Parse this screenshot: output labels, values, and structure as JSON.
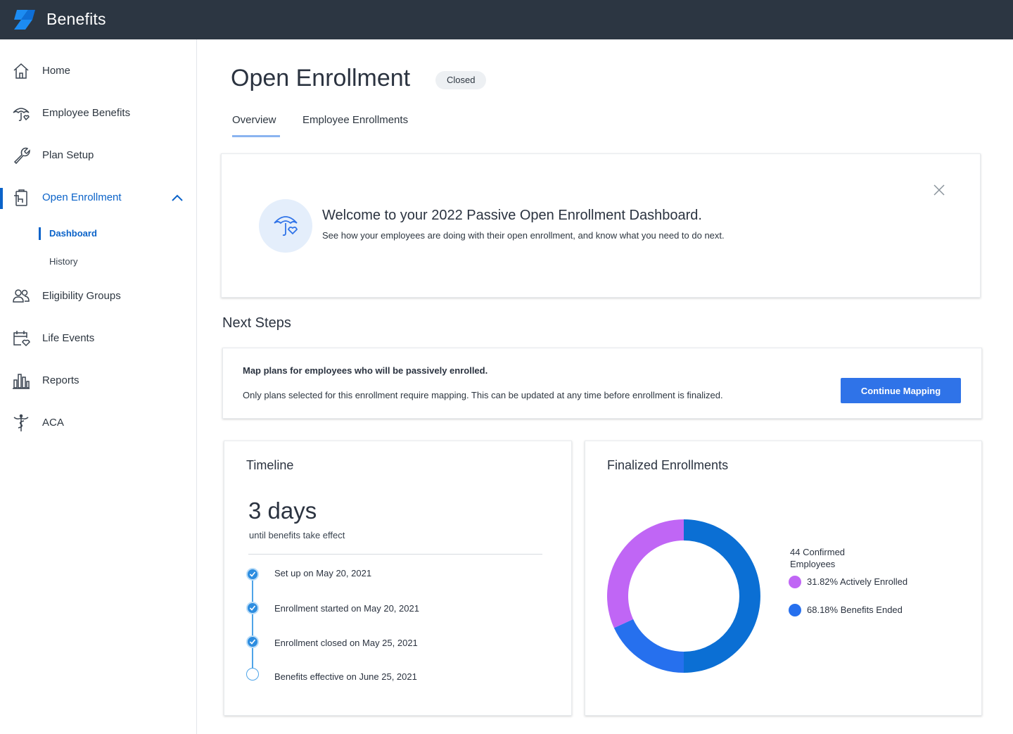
{
  "app": {
    "title": "Benefits",
    "logo_icon": "benefits-logo-icon",
    "brand_color": "#2c3642",
    "accent_color": "#0b63c9"
  },
  "sidebar": {
    "items": [
      {
        "label": "Home",
        "icon": "home-icon"
      },
      {
        "label": "Employee Benefits",
        "icon": "umbrella-heart-icon"
      },
      {
        "label": "Plan Setup",
        "icon": "wrench-icon"
      },
      {
        "label": "Open Enrollment",
        "icon": "clipboard-icon",
        "active": true,
        "expanded": true,
        "children": [
          {
            "label": "Dashboard",
            "active": true
          },
          {
            "label": "History"
          }
        ]
      },
      {
        "label": "Eligibility Groups",
        "icon": "people-icon"
      },
      {
        "label": "Life Events",
        "icon": "calendar-heart-icon"
      },
      {
        "label": "Reports",
        "icon": "bar-chart-icon"
      },
      {
        "label": "ACA",
        "icon": "caduceus-icon"
      }
    ]
  },
  "page": {
    "title": "Open Enrollment",
    "status": "Closed"
  },
  "tabs": [
    {
      "label": "Overview",
      "active": true
    },
    {
      "label": "Employee Enrollments"
    }
  ],
  "welcome": {
    "title": "Welcome to your 2022 Passive Open Enrollment Dashboard.",
    "subtitle": "See how your employees are doing with their open enrollment, and know what you need to do next.",
    "icon": "umbrella-heart-icon"
  },
  "next_steps": {
    "heading": "Next Steps",
    "title": "Map plans for employees who will be passively enrolled.",
    "description": "Only plans selected for this enrollment require mapping. This can be updated at any time before enrollment is finalized.",
    "button_label": "Continue Mapping"
  },
  "timeline": {
    "title": "Timeline",
    "days": "3 days",
    "days_caption": "until benefits take effect",
    "events": [
      {
        "label": "Set up on May 20, 2021",
        "done": true
      },
      {
        "label": "Enrollment started on May 20, 2021",
        "done": true
      },
      {
        "label": "Enrollment closed on May 25, 2021",
        "done": true
      },
      {
        "label": "Benefits effective on June 25, 2021",
        "done": false
      }
    ]
  },
  "finalized": {
    "title": "Finalized Enrollments",
    "legend_heading": "44 Confirmed Employees"
  },
  "chart_data": {
    "type": "pie",
    "donut": true,
    "categories": [
      "31.82% Actively Enrolled",
      "68.18% Benefits Ended"
    ],
    "values": [
      31.82,
      68.18
    ],
    "colors": [
      "#c066f5",
      "#2670ee"
    ],
    "segment_colors": [
      "#c066f5",
      "#2670ee",
      "#0b6fd4"
    ],
    "total_label": "44 Confirmed Employees"
  }
}
